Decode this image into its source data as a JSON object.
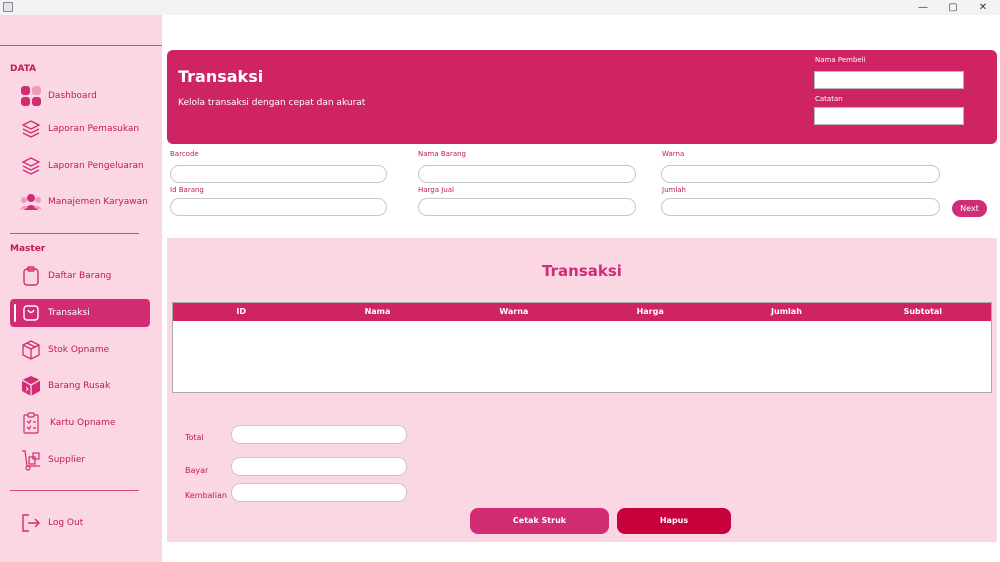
{
  "window": {
    "minimize": "—",
    "maximize": "▢",
    "close": "✕"
  },
  "sidebar": {
    "data_label": "DATA",
    "master_label": "Master",
    "data_items": [
      {
        "label": "Dashboard",
        "icon": "dashboard-icon"
      },
      {
        "label": "Laporan Pemasukan",
        "icon": "layers-icon"
      },
      {
        "label": "Laporan Pengeluaran",
        "icon": "layers-icon"
      },
      {
        "label": "Manajemen Karyawan",
        "icon": "people-icon"
      }
    ],
    "master_items": [
      {
        "label": "Daftar Barang",
        "icon": "clipboard-icon"
      },
      {
        "label": "Transaksi",
        "icon": "shopping-bag-icon",
        "active": true
      },
      {
        "label": "Stok Opname",
        "icon": "box-icon"
      },
      {
        "label": "Barang Rusak",
        "icon": "damaged-box-icon"
      },
      {
        "label": "Kartu Opname",
        "icon": "checklist-icon"
      },
      {
        "label": "Supplier",
        "icon": "dolly-icon"
      }
    ],
    "logout": "Log Out"
  },
  "header": {
    "title": "Transaksi",
    "subtitle": "Kelola transaksi dengan cepat dan akurat",
    "buyer_label": "Nama Pembeli",
    "buyer_value": "",
    "note_label": "Catatan",
    "note_value": ""
  },
  "form": {
    "barcode_label": "Barcode",
    "item_name_label": "Nama Barang",
    "color_label": "Warna",
    "item_id_label": "Id Barang",
    "price_label": "Harga Jual",
    "qty_label": "Jumlah",
    "next_label": "Next"
  },
  "table": {
    "title": "Transaksi",
    "columns": [
      "ID",
      "Nama",
      "Warna",
      "Harga",
      "Jumlah",
      "Subtotal"
    ],
    "rows": []
  },
  "summary": {
    "total_label": "Total",
    "pay_label": "Bayar",
    "change_label": "Kembalian",
    "print_label": "Cetak Struk",
    "delete_label": "Hapus"
  },
  "colors": {
    "primary": "#cf2463",
    "sidebar_bg": "#fbd7e4",
    "danger": "#c8003c"
  }
}
